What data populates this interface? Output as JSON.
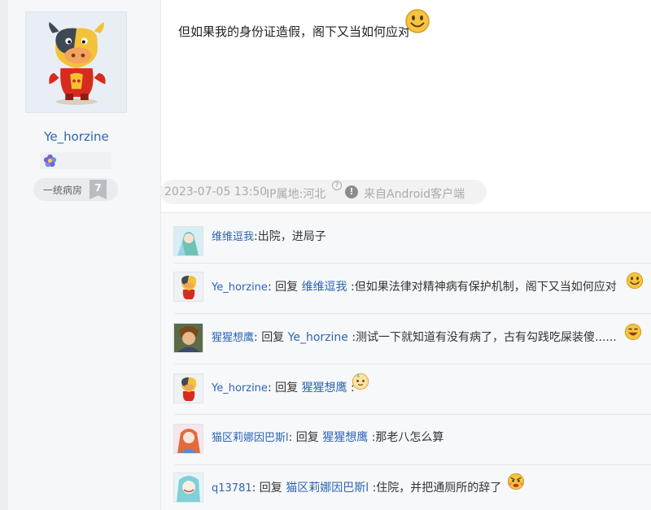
{
  "author": {
    "name": "Ye_horzine",
    "level_name": "一统病房",
    "level_num": "7"
  },
  "post": {
    "text": "但如果我的身份证造假，阁下又当如何应对"
  },
  "meta": {
    "date": "2023-07-05 13:50",
    "ip": "IP属地:河北",
    "question_mark": "?",
    "warn_mark": "!",
    "client": "来自Android客户端"
  },
  "replies": [
    {
      "user": "维维逗我",
      "reply_word": "",
      "target": "",
      "text": ":出院，进局子"
    },
    {
      "user": "Ye_horzine",
      "reply_word": "回复",
      "target": "维维逗我",
      "text": ":但如果法律对精神病有保护机制，阁下又当如何应对"
    },
    {
      "user": "猩猩想鹰",
      "reply_word": "回复",
      "target": "Ye_horzine",
      "text": ":测试一下就知道有没有病了，古有勾践吃屎装傻......"
    },
    {
      "user": "Ye_horzine",
      "reply_word": "回复",
      "target": "猩猩想鹰",
      "text": ":"
    },
    {
      "user": "猫区莉娜因巴斯l",
      "reply_word": "回复",
      "target": "猩猩想鹰",
      "text": ":那老八怎么算"
    },
    {
      "user": "q13781",
      "reply_word": "回复",
      "target": "猫区莉娜因巴斯l",
      "text": ":住院，并把通厕所的辞了"
    }
  ],
  "icons": {
    "author_avatar": "cartoon-bull-avatar-icon",
    "badge": "purple-flower-badge-icon",
    "emoji_smile": "smiley-emoji-icon",
    "emoji_angry": "angry-emoji-icon",
    "emoji_laugh": "laughing-emoji-icon"
  },
  "colors": {
    "link": "#2d64b3",
    "meta_text": "#aaaaaa",
    "side_bg": "#f6f7f9"
  }
}
